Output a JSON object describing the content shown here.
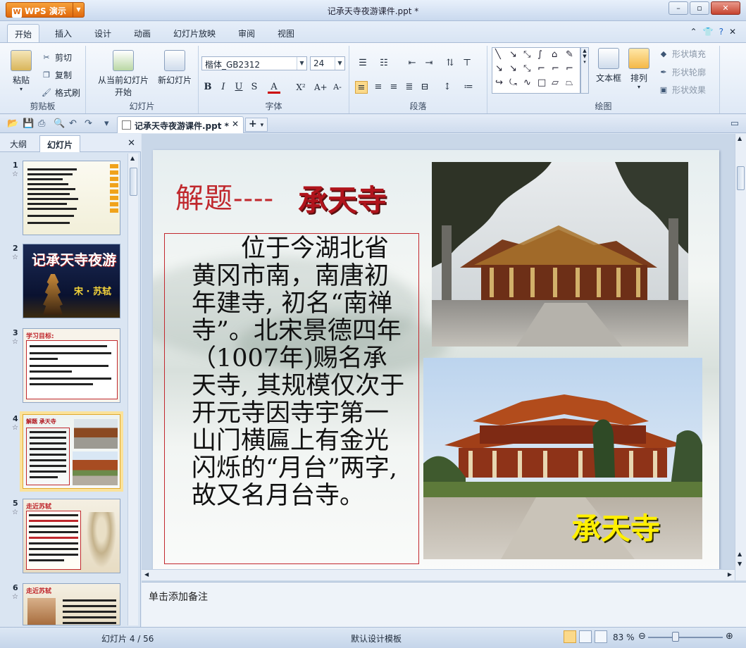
{
  "app": {
    "menu_button": "WPS 演示",
    "window_title": "记承天寺夜游课件.ppt *"
  },
  "menu": {
    "tabs": [
      "开始",
      "插入",
      "设计",
      "动画",
      "幻灯片放映",
      "审阅",
      "视图"
    ],
    "active": "开始"
  },
  "ribbon": {
    "clipboard": {
      "label": "剪贴板",
      "paste": "粘贴",
      "cut": "剪切",
      "copy": "复制",
      "format_painter": "格式刷"
    },
    "slides": {
      "label": "幻灯片",
      "from_current_line1": "从当前幻灯片",
      "from_current_line2": "开始",
      "new_slide": "新幻灯片"
    },
    "font": {
      "label": "字体",
      "family": "楷体_GB2312",
      "size": "24",
      "bold": "B",
      "italic": "I",
      "underline": "U",
      "strike": "S",
      "color": "A",
      "super": "X²",
      "grow": "A+",
      "shrink": "A-"
    },
    "paragraph": {
      "label": "段落"
    },
    "drawing": {
      "label": "绘图",
      "textbox": "文本框",
      "arrange": "排列",
      "shape_fill": "形状填充",
      "shape_outline": "形状轮廓",
      "shape_effect": "形状效果"
    }
  },
  "doc_tab": {
    "name": "记承天寺夜游课件.ppt *"
  },
  "left_panel": {
    "tabs": [
      "大纲",
      "幻灯片"
    ],
    "active": "幻灯片",
    "thumbnails": [
      {
        "num": "1",
        "title": ""
      },
      {
        "num": "2",
        "title": "记承天寺夜游",
        "subtitle": "宋 · 苏轼"
      },
      {
        "num": "3",
        "title": "学习目标:"
      },
      {
        "num": "4",
        "title": "解题 承天寺",
        "selected": true
      },
      {
        "num": "5",
        "title": "走近苏轼"
      },
      {
        "num": "6",
        "title": "走近苏轼"
      }
    ]
  },
  "slide": {
    "title_red": "解题----",
    "title_dark": "承天寺",
    "body": "位于今湖北省黄冈市南，南唐初年建寺, 初名“南禅寺”。北宋景德四年（1007年)赐名承天寺, 其规模仅次于开元寺因寺宇第一山门横匾上有金光闪烁的“月台”两字, 故又名月台寺。",
    "caption": "承天寺"
  },
  "notes": {
    "placeholder": "单击添加备注"
  },
  "status": {
    "slide_count": "幻灯片 4 / 56",
    "template": "默认设计模板",
    "zoom": "83 %"
  },
  "colors": {
    "title_red": "#c0282d",
    "caption_yellow": "#ffef00",
    "wps_orange": "#e0680d"
  }
}
